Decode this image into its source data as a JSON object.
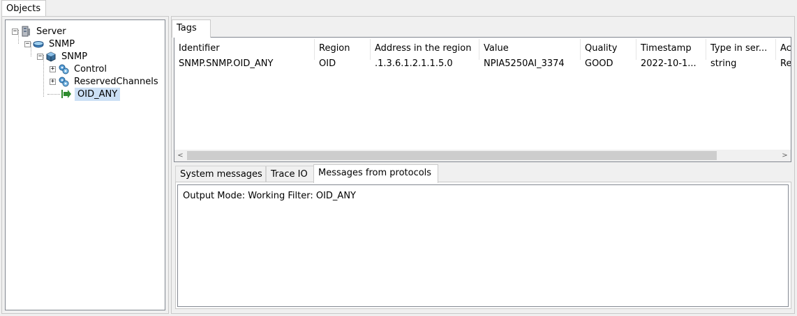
{
  "objects_tab": {
    "label": "Objects"
  },
  "tree": {
    "nodes": [
      {
        "label": "Server",
        "expander": "−",
        "icon": "server-icon"
      },
      {
        "label": "SNMP",
        "expander": "−",
        "icon": "network-device-icon"
      },
      {
        "label": "SNMP",
        "expander": "−",
        "icon": "device-cube-icon"
      },
      {
        "label": "Control",
        "expander": "+",
        "icon": "gear-group-icon"
      },
      {
        "label": "ReservedChannels",
        "expander": "+",
        "icon": "gear-group-icon"
      },
      {
        "label": "OID_ANY",
        "expander": "",
        "icon": "green-arrow-icon",
        "selected": true
      }
    ]
  },
  "tags_tab": {
    "label": "Tags"
  },
  "tags_table": {
    "columns": [
      "Identifier",
      "Region",
      "Address in the region",
      "Value",
      "Quality",
      "Timestamp",
      "Type in ser...",
      "Ac"
    ],
    "rows": [
      [
        "SNMP.SNMP.OID_ANY",
        "OID",
        ".1.3.6.1.2.1.1.5.0",
        "NPIA5250AI_3374",
        "GOOD",
        "2022-10-1...",
        "string",
        "Re"
      ]
    ]
  },
  "scrollbar": {
    "left_arrow": "<",
    "right_arrow": ">"
  },
  "bottom_tabs": {
    "system_messages": "System messages",
    "trace_io": "Trace IO",
    "messages_from_protocols": "Messages from protocols"
  },
  "messages": {
    "text": "Output Mode: Working Filter: OID_ANY"
  },
  "colors": {
    "selection": "#cce0f5",
    "border": "#828790",
    "accent_green": "#2e8b2e"
  }
}
